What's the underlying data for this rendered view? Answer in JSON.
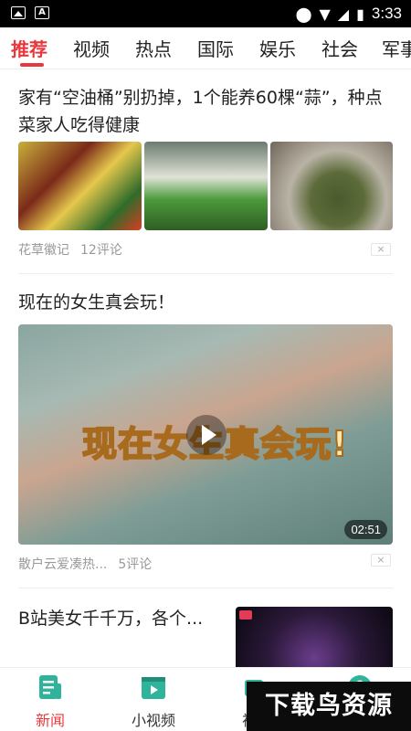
{
  "status_bar": {
    "time": "3:33"
  },
  "tabs": [
    {
      "label": "推荐",
      "active": true
    },
    {
      "label": "视频"
    },
    {
      "label": "热点"
    },
    {
      "label": "国际"
    },
    {
      "label": "娱乐"
    },
    {
      "label": "社会"
    },
    {
      "label": "军事"
    }
  ],
  "feed": [
    {
      "title": "家有“空油桶”别扔掉，1个能养60棵“蒜”，种点菜家人吃得健康",
      "source": "花草徽记",
      "comments": "12评论",
      "dismiss": "×"
    },
    {
      "title": "现在的女生真会玩！",
      "video_caption": "现在女生真会玩!",
      "duration": "02:51",
      "source": "散户云爱凑热...",
      "comments": "5评论",
      "dismiss": "×"
    },
    {
      "title": "B站美女千千万，各个..."
    }
  ],
  "bottom_nav": [
    {
      "label": "新闻",
      "icon": "news-icon",
      "active": true
    },
    {
      "label": "小视频",
      "icon": "video-icon"
    },
    {
      "label": "视频",
      "icon": "camera-icon"
    },
    {
      "label": "我的",
      "icon": "profile-icon"
    }
  ],
  "watermark": "下载鸟资源",
  "colors": {
    "accent": "#e8383d",
    "nav_icon": "#2fb49b"
  }
}
